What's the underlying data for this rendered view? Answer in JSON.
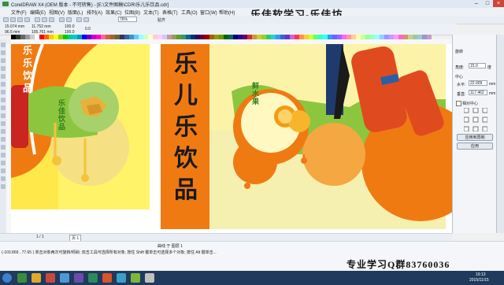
{
  "window": {
    "title": "CorelDRAW X4 (OEM 版本 - 不可转售) - [E:\\文件图稿\\CDR\\乐儿乐饮品.cdr]"
  },
  "watermark_top": "乐佳软学习-乐佳坊",
  "menu": [
    "文件(F)",
    "编辑(E)",
    "视图(V)",
    "版面(L)",
    "排列(A)",
    "效果(C)",
    "位图(B)",
    "文本(T)",
    "表格(T)",
    "工具(O)",
    "窗口(W)",
    "帮助(H)"
  ],
  "toolbar": {
    "zoom": "76%",
    "snap": "贴齐"
  },
  "propbar": {
    "x": "15.074 mm",
    "y": "96.5 mm",
    "w": "11.752 mm",
    "h": "105.761 mm",
    "scale_w": "100.0",
    "scale_h": "100.0",
    "rotation": "0.0"
  },
  "artwork": {
    "left_vertical_text": "乐乐饮品",
    "left_green_text": "乐佳饮品",
    "center_title": "乐儿乐饮品",
    "center_green_text": "鲜水果"
  },
  "docker": {
    "title": "旋转",
    "angle_label": "角度:",
    "angle_value": "15.0",
    "angle_unit": "度",
    "center_label": "中心",
    "x_label": "水平:",
    "x_value": "22.009",
    "y_label": "垂直:",
    "y_value": "117.462",
    "unit": "mm",
    "relative_center_label": "相对中心",
    "apply_copy_button": "应用到再制",
    "apply_button": "应用"
  },
  "pagebar": {
    "page_info": "1 / 1",
    "page_tab": "页 1"
  },
  "status": {
    "line1": "曲线 于 图层 1",
    "line2": "(-103.869 , 77.65 ) 单击对象两次可旋转/倾斜; 双击工具可选择所有对象; 按住 Shift 键单击可选择多个对象; 按住 Alt 键单击...",
    "qq": "专业学习Q群83760036",
    "clock_time": "19:13",
    "clock_date": "2015/11/15"
  },
  "colors": {
    "orange": "#f07a12",
    "green": "#8cc63f",
    "yellow": "#ffe94a",
    "pale_yellow": "#f5f0b0",
    "accent_blue": "#2a5fa8"
  }
}
